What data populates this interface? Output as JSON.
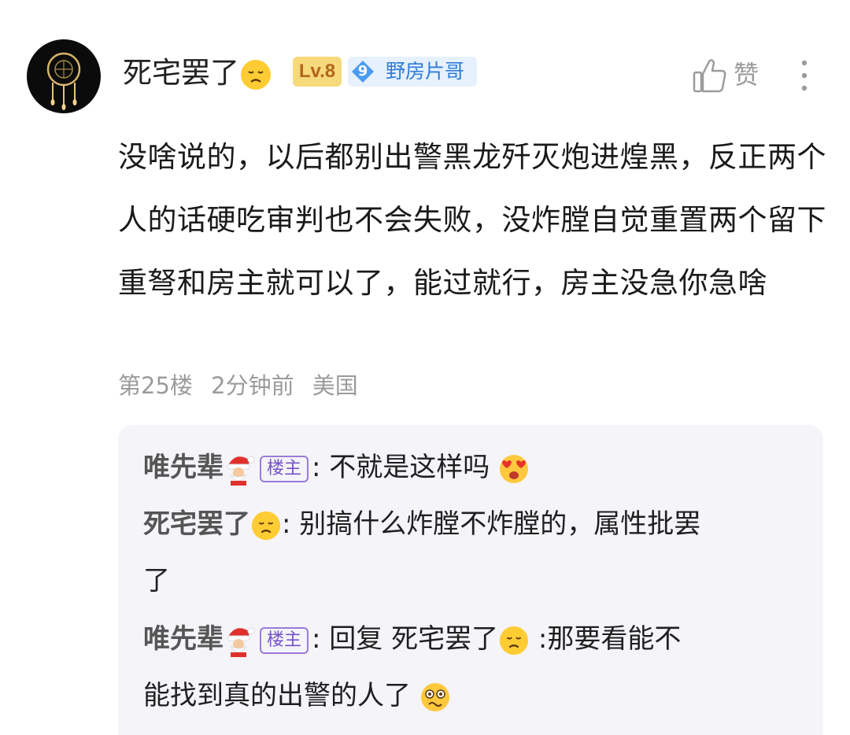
{
  "comment": {
    "username": "死宅罢了",
    "level": "Lv.8",
    "title_badge": {
      "number": "9",
      "text": "野房片哥"
    },
    "like_label": "赞",
    "content": "没啥说的，以后都别出警黑龙歼灭炮进煌黑，反正两个人的话硬吃审判也不会失败，没炸膛自觉重置两个留下重弩和房主就可以了，能过就行，房主没急你急啥",
    "meta": {
      "floor": "第25楼",
      "time": "2分钟前",
      "location": "美国"
    }
  },
  "replies": [
    {
      "name": "唯先辈",
      "badge": "楼主",
      "separator": ":",
      "text": "不就是这样吗"
    },
    {
      "name": "死宅罢了",
      "separator": ":",
      "text_line1": "别搞什么炸膛不炸膛的，属性批罢",
      "text_line2": "了"
    },
    {
      "name": "唯先辈",
      "badge": "楼主",
      "separator": ":",
      "reply_prefix": "回复",
      "reply_to": "死宅罢了",
      "text_after": ":那要看能不",
      "text_line2": "能找到真的出警的人了"
    }
  ],
  "icons": {
    "avatar": "dreamcatcher-avatar",
    "username_emoji": "sad-face-icon",
    "like": "thumbs-up-icon",
    "more": "more-vertical-icon",
    "santa": "santa-icon",
    "heart_eyes": "heart-eyes-icon",
    "dizzy": "dizzy-face-icon"
  },
  "colors": {
    "level_bg": "#f6d97b",
    "level_fg": "#b2661c",
    "title_bg": "#e6f1fd",
    "title_fg": "#2f7cd8",
    "host_badge": "#7653c8",
    "reply_bg": "#f4f4f9"
  }
}
